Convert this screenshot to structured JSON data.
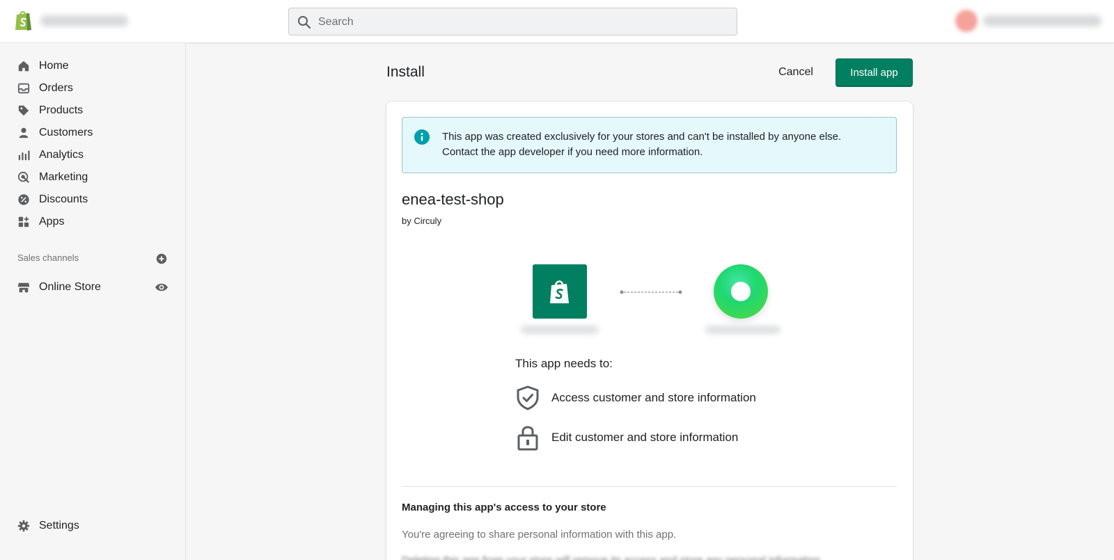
{
  "topbar": {
    "search_placeholder": "Search"
  },
  "sidebar": {
    "items": [
      {
        "label": "Home",
        "icon": "home-icon"
      },
      {
        "label": "Orders",
        "icon": "orders-icon"
      },
      {
        "label": "Products",
        "icon": "tag-icon"
      },
      {
        "label": "Customers",
        "icon": "person-icon"
      },
      {
        "label": "Analytics",
        "icon": "bar-chart-icon"
      },
      {
        "label": "Marketing",
        "icon": "target-icon"
      },
      {
        "label": "Discounts",
        "icon": "discount-icon"
      },
      {
        "label": "Apps",
        "icon": "apps-icon"
      }
    ],
    "sales_channels_title": "Sales channels",
    "online_store_label": "Online Store",
    "settings_label": "Settings"
  },
  "page": {
    "title": "Install",
    "cancel_label": "Cancel",
    "install_label": "Install app"
  },
  "banner": {
    "line1": "This app was created exclusively for your stores and can't be installed by anyone else.",
    "line2": "Contact the app developer if you need more information."
  },
  "app": {
    "name": "enea-test-shop",
    "by": "by Circuly"
  },
  "permissions": {
    "title": "This app needs to:",
    "items": [
      {
        "label": "Access customer and store information",
        "icon": "shield-check-icon"
      },
      {
        "label": "Edit customer and store information",
        "icon": "lock-icon"
      }
    ]
  },
  "management": {
    "title": "Managing this app's access to your store",
    "text": "You're agreeing to share personal information with this app.",
    "text2": "Deleting this app from your store will remove its access and store any personal information"
  },
  "colors": {
    "primary": "#008060",
    "banner_bg": "#e5f8fb",
    "info": "#00a0ac"
  }
}
